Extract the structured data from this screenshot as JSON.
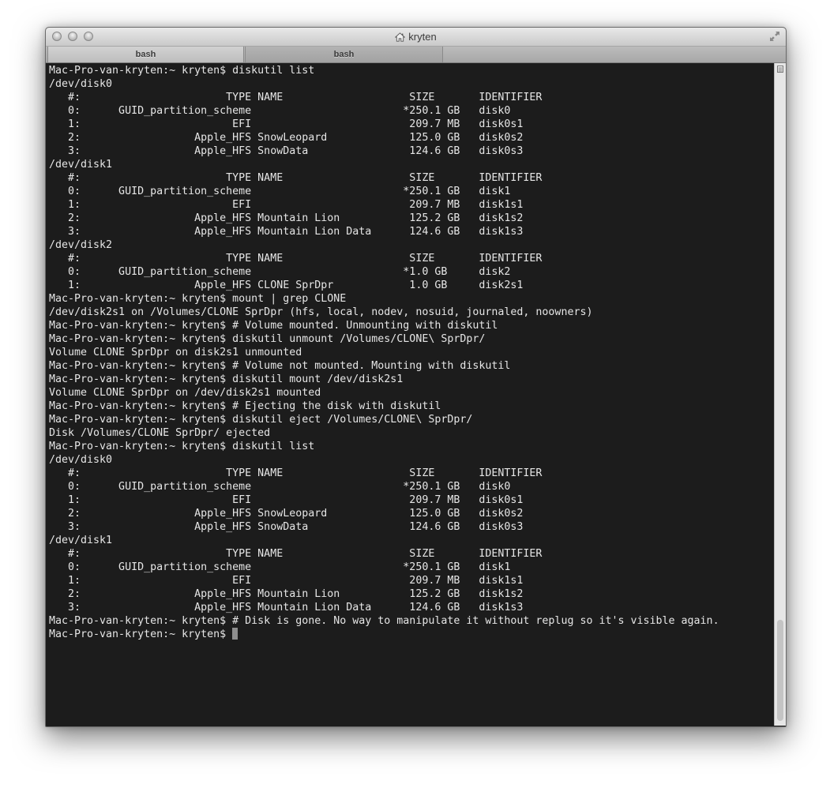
{
  "window": {
    "title": "kryten",
    "icon": "home-icon"
  },
  "tabs": [
    {
      "label": "bash",
      "active": true
    },
    {
      "label": "bash",
      "active": false
    }
  ],
  "terminal": {
    "prompt": "Mac-Pro-van-kryten:~ kryten$ ",
    "lines": [
      "Mac-Pro-van-kryten:~ kryten$ diskutil list",
      "/dev/disk0",
      "   #:                       TYPE NAME                    SIZE       IDENTIFIER",
      "   0:      GUID_partition_scheme                        *250.1 GB   disk0",
      "   1:                        EFI                         209.7 MB   disk0s1",
      "   2:                  Apple_HFS SnowLeopard             125.0 GB   disk0s2",
      "   3:                  Apple_HFS SnowData                124.6 GB   disk0s3",
      "/dev/disk1",
      "   #:                       TYPE NAME                    SIZE       IDENTIFIER",
      "   0:      GUID_partition_scheme                        *250.1 GB   disk1",
      "   1:                        EFI                         209.7 MB   disk1s1",
      "   2:                  Apple_HFS Mountain Lion           125.2 GB   disk1s2",
      "   3:                  Apple_HFS Mountain Lion Data      124.6 GB   disk1s3",
      "/dev/disk2",
      "   #:                       TYPE NAME                    SIZE       IDENTIFIER",
      "   0:      GUID_partition_scheme                        *1.0 GB     disk2",
      "   1:                  Apple_HFS CLONE SprDpr            1.0 GB     disk2s1",
      "Mac-Pro-van-kryten:~ kryten$ mount | grep CLONE",
      "/dev/disk2s1 on /Volumes/CLONE SprDpr (hfs, local, nodev, nosuid, journaled, noowners)",
      "Mac-Pro-van-kryten:~ kryten$ # Volume mounted. Unmounting with diskutil",
      "Mac-Pro-van-kryten:~ kryten$ diskutil unmount /Volumes/CLONE\\ SprDpr/",
      "Volume CLONE SprDpr on disk2s1 unmounted",
      "Mac-Pro-van-kryten:~ kryten$ # Volume not mounted. Mounting with diskutil",
      "Mac-Pro-van-kryten:~ kryten$ diskutil mount /dev/disk2s1",
      "Volume CLONE SprDpr on /dev/disk2s1 mounted",
      "Mac-Pro-van-kryten:~ kryten$ # Ejecting the disk with diskutil",
      "Mac-Pro-van-kryten:~ kryten$ diskutil eject /Volumes/CLONE\\ SprDpr/",
      "Disk /Volumes/CLONE SprDpr/ ejected",
      "Mac-Pro-van-kryten:~ kryten$ diskutil list",
      "/dev/disk0",
      "   #:                       TYPE NAME                    SIZE       IDENTIFIER",
      "   0:      GUID_partition_scheme                        *250.1 GB   disk0",
      "   1:                        EFI                         209.7 MB   disk0s1",
      "   2:                  Apple_HFS SnowLeopard             125.0 GB   disk0s2",
      "   3:                  Apple_HFS SnowData                124.6 GB   disk0s3",
      "/dev/disk1",
      "   #:                       TYPE NAME                    SIZE       IDENTIFIER",
      "   0:      GUID_partition_scheme                        *250.1 GB   disk1",
      "   1:                        EFI                         209.7 MB   disk1s1",
      "   2:                  Apple_HFS Mountain Lion           125.2 GB   disk1s2",
      "   3:                  Apple_HFS Mountain Lion Data      124.6 GB   disk1s3",
      "Mac-Pro-van-kryten:~ kryten$ # Disk is gone. No way to manipulate it without replug so it's visible again."
    ]
  },
  "colors": {
    "terminal_background": "#1c1c1c",
    "terminal_text": "#e6e6e6",
    "cursor": "#8e8e8e"
  },
  "scrollbar": {
    "icon": "split-pane-icon"
  }
}
